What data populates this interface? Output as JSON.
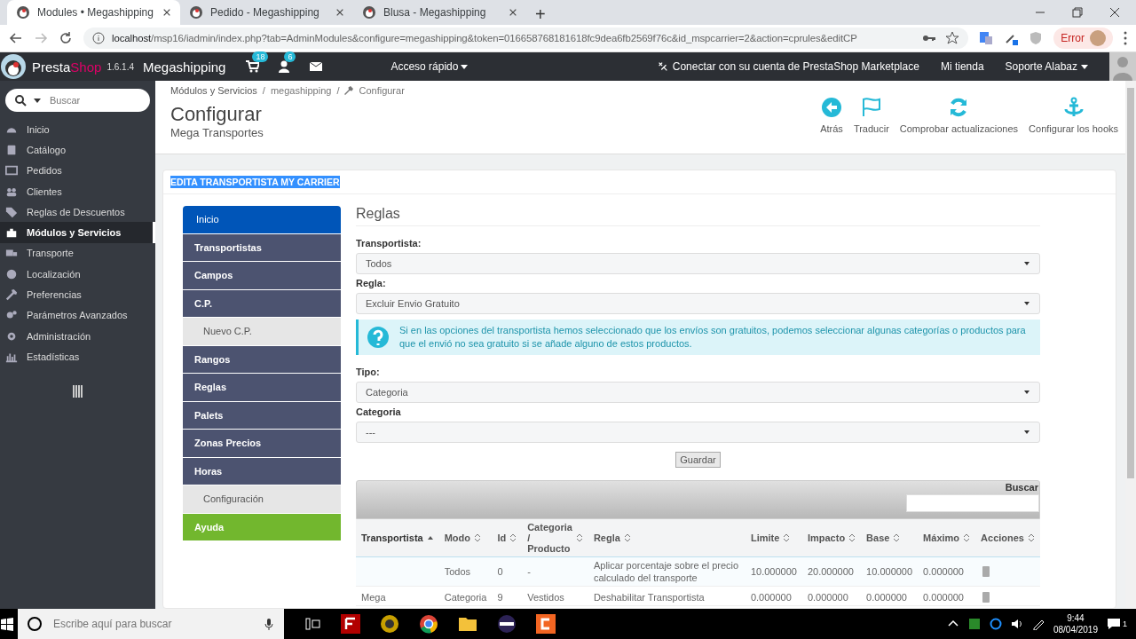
{
  "browser": {
    "tabs": [
      {
        "title": "Modules • Megashipping",
        "selected": true
      },
      {
        "title": "Pedido - Megashipping",
        "selected": false
      },
      {
        "title": "Blusa - Megashipping",
        "selected": false
      }
    ],
    "new_tab": "+",
    "url_host": "localhost",
    "url_path": "/msp16/iadmin/index.php?tab=AdminModules&configure=megashipping&token=016658768181618fc9dea6fb2569f76c&id_mspcarrier=2&action=cprules&editCP",
    "profile_status": "Error"
  },
  "header": {
    "brand_first": "Presta",
    "brand_second": "Shop",
    "version": "1.6.1.4",
    "shop": "Megashipping",
    "cart_count": "18",
    "customers_count": "6",
    "quick_access": "Acceso rápido",
    "connect": "Conectar con su cuenta de PrestaShop Marketplace",
    "my_shop": "Mi tienda",
    "employee": "Soporte Alabaz"
  },
  "sidebar": {
    "search_placeholder": "Buscar",
    "items": [
      {
        "label": "Inicio",
        "selected": false
      },
      {
        "label": "Catálogo",
        "selected": false
      },
      {
        "label": "Pedidos",
        "selected": false
      },
      {
        "label": "Clientes",
        "selected": false
      },
      {
        "label": "Reglas de Descuentos",
        "selected": false
      },
      {
        "label": "Módulos y Servicios",
        "selected": true
      },
      {
        "label": "Transporte",
        "selected": false
      },
      {
        "label": "Localización",
        "selected": false
      },
      {
        "label": "Preferencias",
        "selected": false
      },
      {
        "label": "Parámetros Avanzados",
        "selected": false
      },
      {
        "label": "Administración",
        "selected": false
      },
      {
        "label": "Estadísticas",
        "selected": false
      }
    ]
  },
  "page": {
    "breadcrumb_separator": "/",
    "breadcrumb": [
      "Módulos y Servicios",
      "megashipping",
      "Configurar"
    ],
    "title": "Configurar",
    "subtitle": "Mega Transportes",
    "toolbar": [
      "Atrás",
      "Traducir",
      "Comprobar actualizaciones",
      "Configurar los hooks"
    ]
  },
  "panel": {
    "heading": "EDITA TRANSPORTISTA MY CARRIER",
    "menu": [
      {
        "label": "Inicio",
        "kind": "item",
        "selected": true
      },
      {
        "label": "Transportistas",
        "kind": "item",
        "selected": false
      },
      {
        "label": "Campos",
        "kind": "item",
        "selected": false
      },
      {
        "label": "C.P.",
        "kind": "item",
        "selected": false
      },
      {
        "label": "Nuevo C.P.",
        "kind": "subitem",
        "selected": false
      },
      {
        "label": "Rangos",
        "kind": "item",
        "selected": false
      },
      {
        "label": "Reglas",
        "kind": "item",
        "selected": false
      },
      {
        "label": "Palets",
        "kind": "item",
        "selected": false
      },
      {
        "label": "Zonas Precios",
        "kind": "item",
        "selected": false
      },
      {
        "label": "Horas",
        "kind": "item",
        "selected": false
      },
      {
        "label": "Configuración",
        "kind": "subitem",
        "selected": false
      },
      {
        "label": "Ayuda",
        "kind": "help",
        "selected": false
      }
    ],
    "form_title": "Reglas",
    "fields": [
      {
        "label": "Transportista:",
        "value": "Todos"
      },
      {
        "label": "Regla:",
        "value": "Excluir Envio Gratuito"
      }
    ],
    "info": "Si en las opciones del transportista hemos seleccionado que los envíos son gratuitos, podemos seleccionar algunas categorías o productos para que el envió no sea gratuito si se añade alguno de estos productos.",
    "fields2": [
      {
        "label": "Tipo:",
        "value": "Categoria"
      },
      {
        "label": "Categoria",
        "value": "---"
      }
    ],
    "save": "Guardar",
    "table": {
      "search_label": "Buscar",
      "columns": [
        {
          "label": "Transportista",
          "sorted": true
        },
        {
          "label": "Modo",
          "sorted": false
        },
        {
          "label": "Id",
          "sorted": false
        },
        {
          "label": "Categoria / Producto",
          "sorted": false
        },
        {
          "label": "Regla",
          "sorted": false
        },
        {
          "label": "Limite",
          "sorted": false
        },
        {
          "label": "Impacto",
          "sorted": false
        },
        {
          "label": "Base",
          "sorted": false
        },
        {
          "label": "Máximo",
          "sorted": false
        },
        {
          "label": "Acciones",
          "sorted": false
        }
      ],
      "rows": [
        [
          "",
          "Todos",
          "0",
          "-",
          "Aplicar porcentaje sobre el precio calculado del transporte",
          "10.000000",
          "20.000000",
          "10.000000",
          "0.000000"
        ],
        [
          "Mega",
          "Categoria",
          "9",
          "Vestidos",
          "Deshabilitar Transportista",
          "0.000000",
          "0.000000",
          "0.000000",
          "0.000000"
        ]
      ]
    }
  },
  "taskbar": {
    "search_placeholder": "Escribe aquí para buscar",
    "time": "9:44",
    "date": "08/04/2019",
    "notifications": "1"
  }
}
